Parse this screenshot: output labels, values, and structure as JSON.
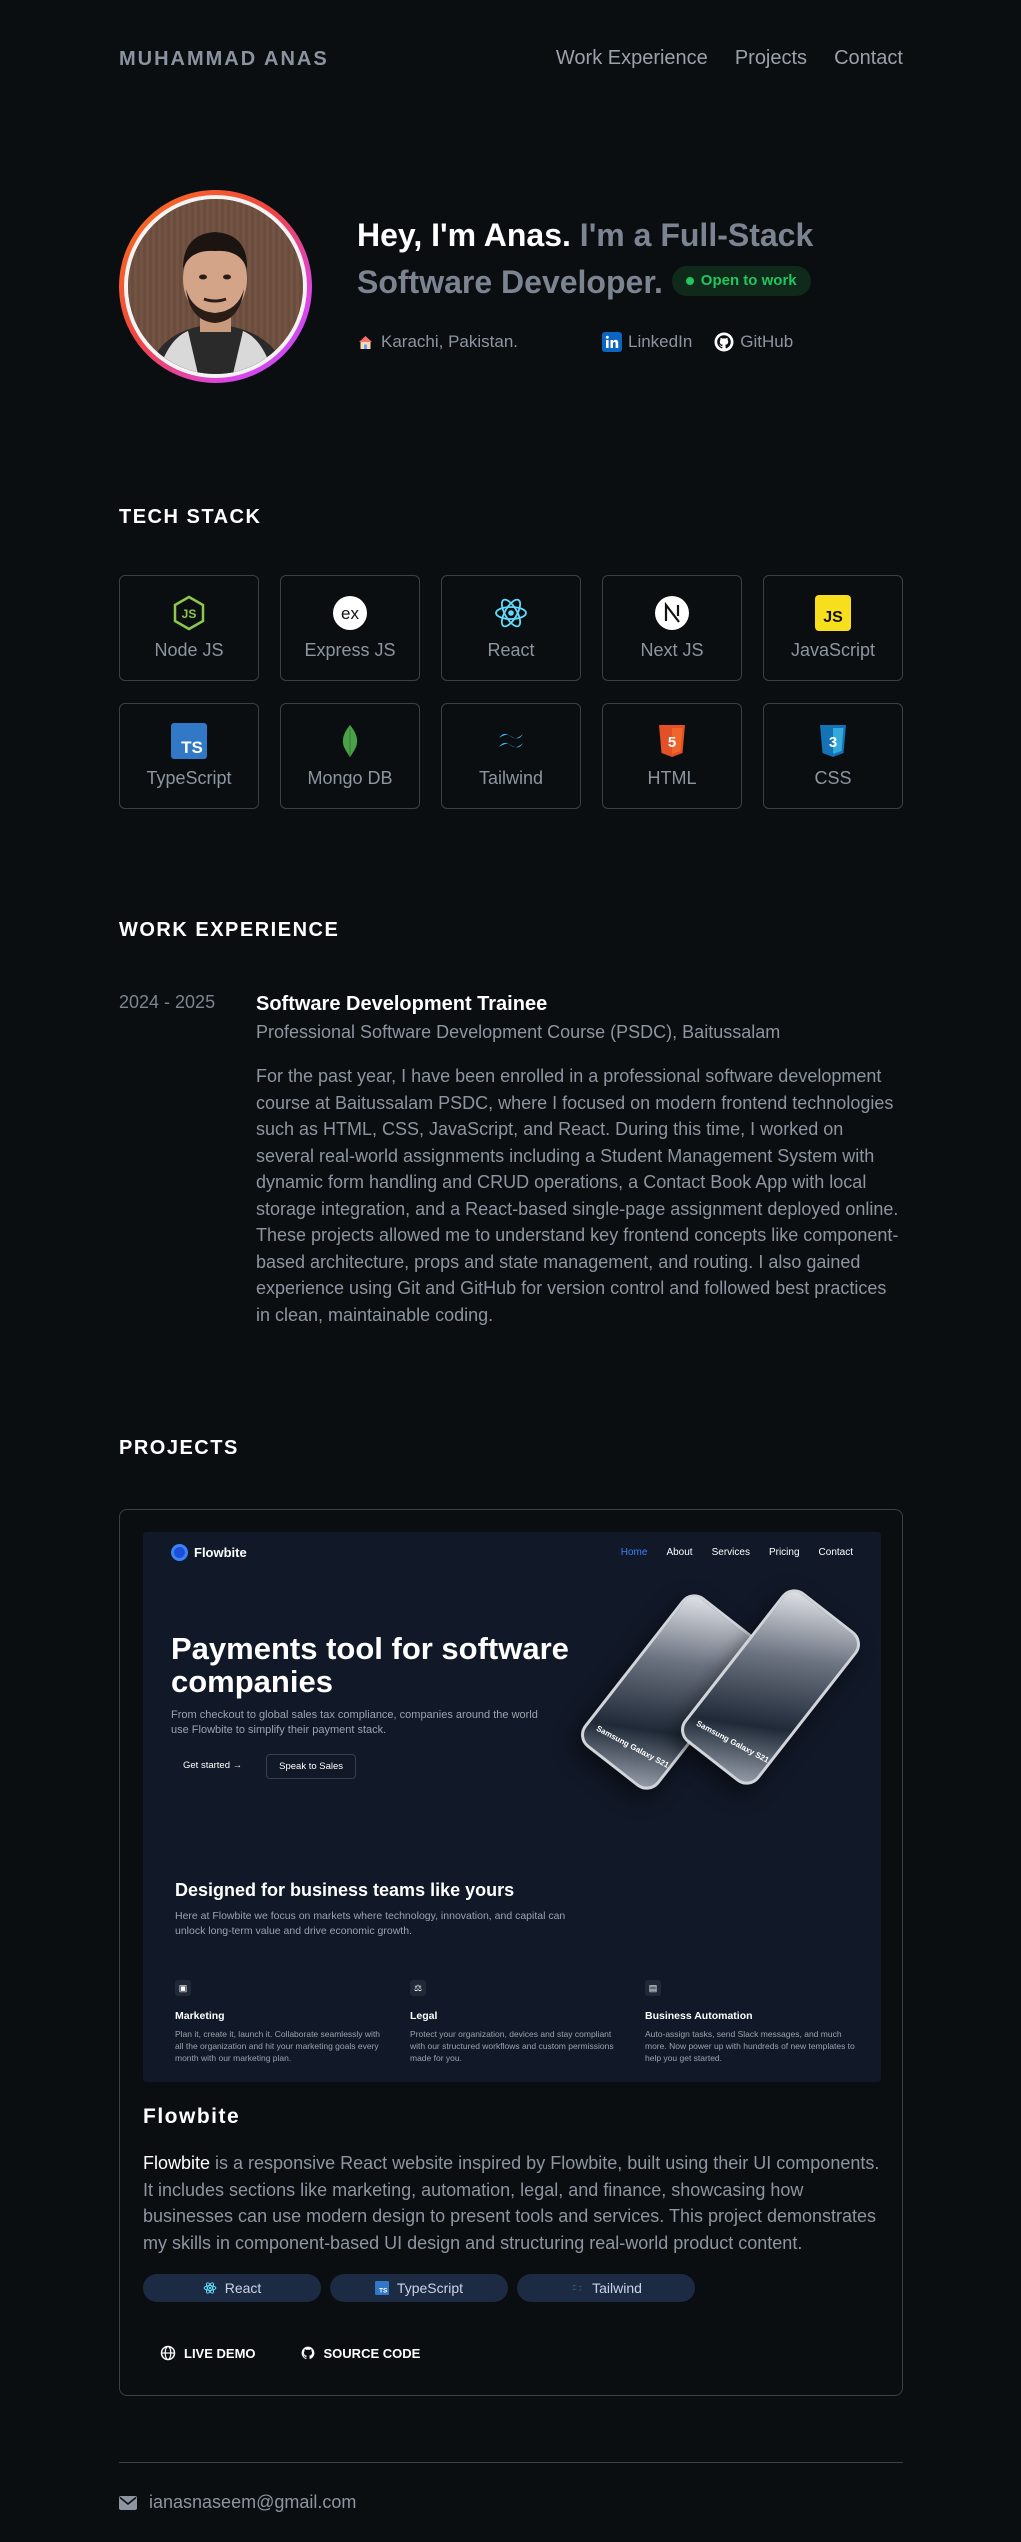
{
  "header": {
    "brand": "MUHAMMAD ANAS",
    "nav": [
      "Work Experience",
      "Projects",
      "Contact"
    ]
  },
  "hero": {
    "greeting": "Hey, I'm Anas.",
    "role_line1": "I'm a Full-Stack",
    "role_line2": "Software Developer.",
    "badge": "Open to work",
    "location": "Karachi, Pakistan.",
    "linkedin": "LinkedIn",
    "github": "GitHub"
  },
  "tech": {
    "heading": "TECH STACK",
    "items": [
      {
        "label": "Node JS",
        "icon": "nodejs-icon"
      },
      {
        "label": "Express JS",
        "icon": "express-icon"
      },
      {
        "label": "React",
        "icon": "react-icon"
      },
      {
        "label": "Next JS",
        "icon": "nextjs-icon"
      },
      {
        "label": "JavaScript",
        "icon": "javascript-icon"
      },
      {
        "label": "TypeScript",
        "icon": "typescript-icon"
      },
      {
        "label": "Mongo DB",
        "icon": "mongodb-icon"
      },
      {
        "label": "Tailwind",
        "icon": "tailwind-icon"
      },
      {
        "label": "HTML",
        "icon": "html-icon"
      },
      {
        "label": "CSS",
        "icon": "css-icon"
      }
    ]
  },
  "experience": {
    "heading": "WORK EXPERIENCE",
    "date": "2024 - 2025",
    "title": "Software Development Trainee",
    "org": "Professional Software Development Course (PSDC), Baitussalam",
    "description": "For the past year, I have been enrolled in a professional software development course at Baitussalam PSDC, where I focused on modern frontend technologies such as HTML, CSS, JavaScript, and React. During this time, I worked on several real-world assignments including a Student Management System with dynamic form handling and CRUD operations, a Contact Book App with local storage integration, and a React-based single-page assignment deployed online. These projects allowed me to understand key frontend concepts like component-based architecture, props and state management, and routing. I also gained experience using Git and GitHub for version control and followed best practices in clean, maintainable coding."
  },
  "projects": {
    "heading": "PROJECTS",
    "preview": {
      "logo": "Flowbite",
      "nav": [
        "Home",
        "About",
        "Services",
        "Pricing",
        "Contact"
      ],
      "h1": "Payments tool for software companies",
      "p": "From checkout to global sales tax compliance, companies around the world use Flowbite to simplify their payment stack.",
      "btn_primary": "Get started →",
      "btn_secondary": "Speak to Sales",
      "phone_label_1": "Samsung Galaxy S21",
      "phone_label_2": "Samsung Galaxy S21",
      "h2": "Designed for business teams like yours",
      "p2": "Here at Flowbite we focus on markets where technology, innovation, and capital can unlock long-term value and drive economic growth.",
      "features": [
        {
          "title": "Marketing",
          "text": "Plan it, create it, launch it. Collaborate seamlessly with all the organization and hit your marketing goals every month with our marketing plan."
        },
        {
          "title": "Legal",
          "text": "Protect your organization, devices and stay compliant with our structured workflows and custom permissions made for you."
        },
        {
          "title": "Business Automation",
          "text": "Auto-assign tasks, send Slack messages, and much more. Now power up with hundreds of new templates to help you get started."
        }
      ]
    },
    "name": "Flowbite",
    "desc_lead": "Flowbite",
    "desc_rest": " is a responsive React website inspired by Flowbite, built using their UI components. It includes sections like marketing, automation, legal, and finance, showcasing how businesses can use modern design to present tools and services. This project demonstrates my skills in component-based UI design and structuring real-world product content.",
    "chips": [
      {
        "label": "React",
        "icon": "react-icon"
      },
      {
        "label": "TypeScript",
        "icon": "typescript-icon"
      },
      {
        "label": "Tailwind",
        "icon": "tailwind-icon"
      }
    ],
    "live_demo": "LIVE DEMO",
    "source_code": "SOURCE CODE"
  },
  "footer": {
    "email": "ianasnaseem@gmail.com"
  },
  "colors": {
    "background": "#0b0e11",
    "accent_green": "#22c55e",
    "chip_bg": "#1c2a44"
  }
}
